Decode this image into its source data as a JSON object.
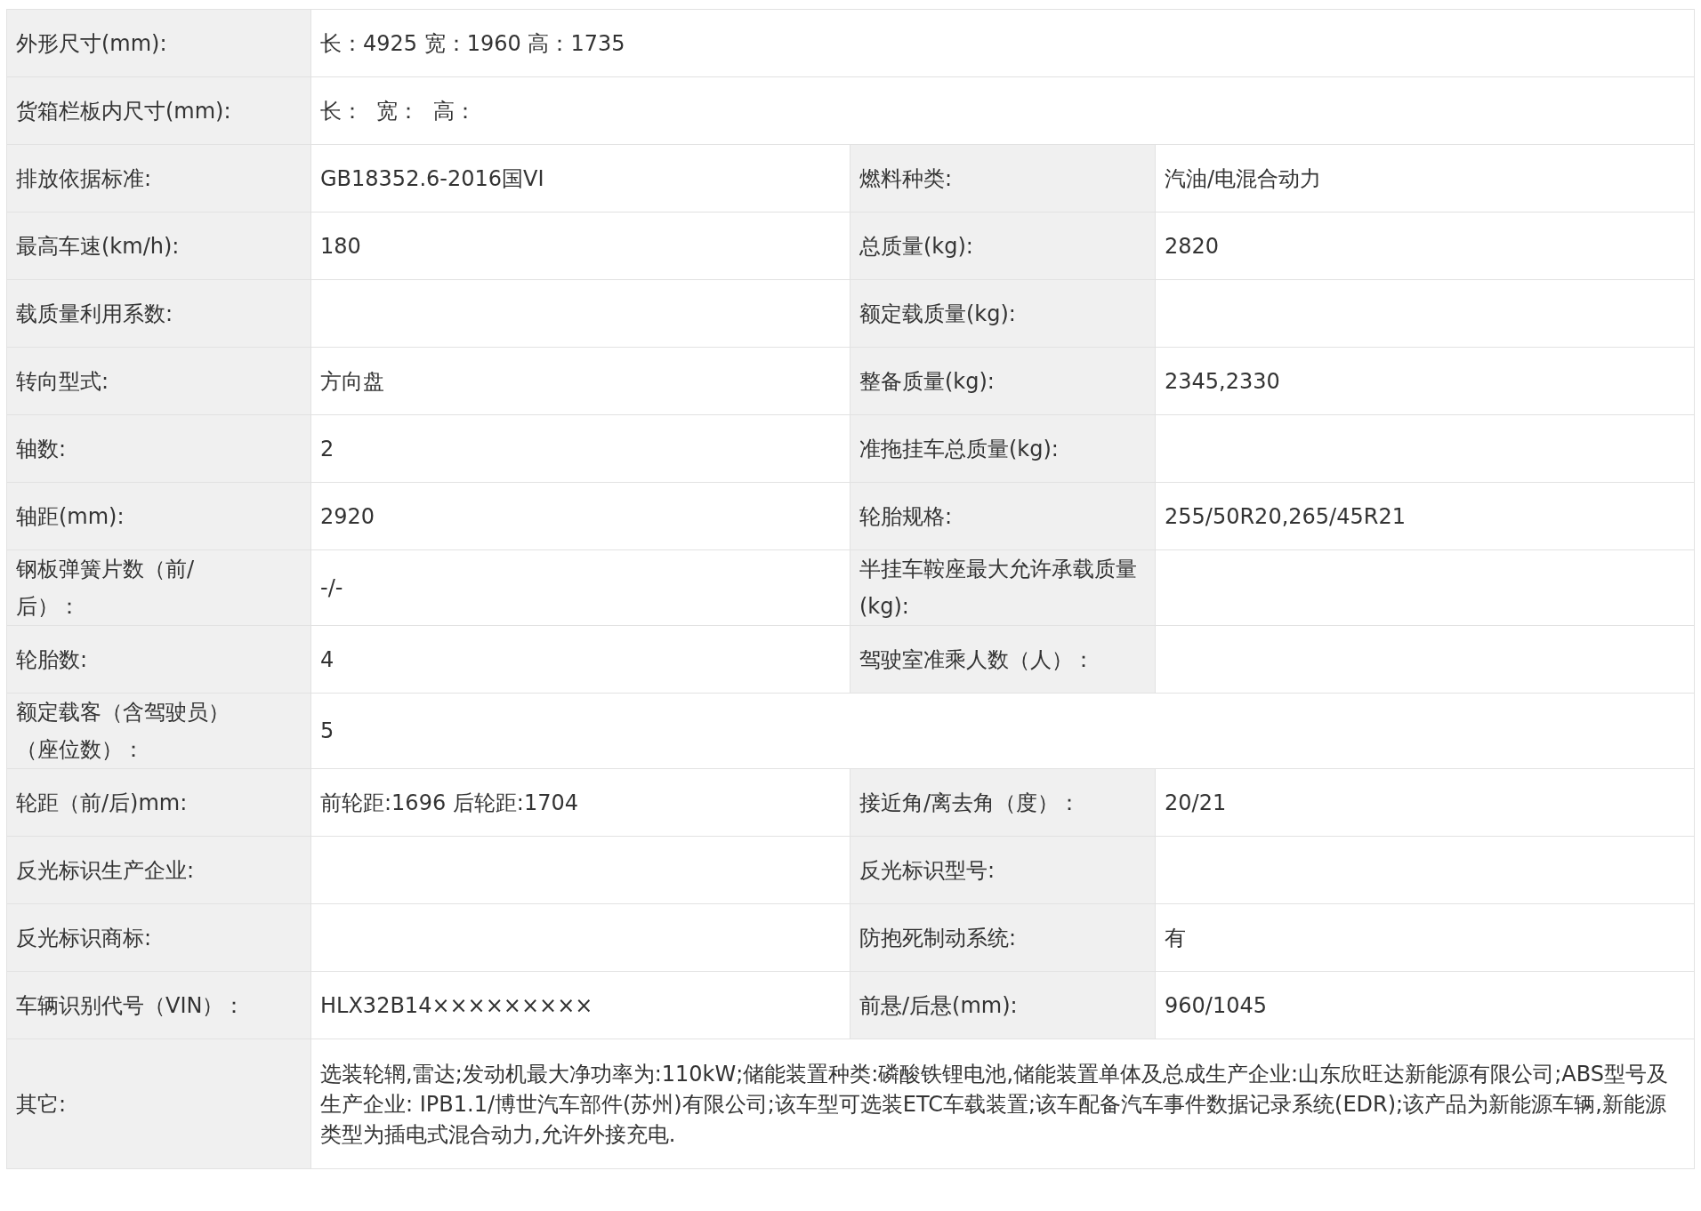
{
  "rows": [
    {
      "kind": "full",
      "label": "外形尺寸(mm):",
      "value": "长：4925 宽：1960 高：1735"
    },
    {
      "kind": "full",
      "label": "货箱栏板内尺寸(mm):",
      "value": "长：  宽：  高："
    },
    {
      "kind": "split",
      "label": "排放依据标准:",
      "value": "GB18352.6-2016国VI",
      "label2": "燃料种类:",
      "value2": "汽油/电混合动力"
    },
    {
      "kind": "split",
      "label": "最高车速(km/h):",
      "value": "180",
      "label2": "总质量(kg):",
      "value2": "2820"
    },
    {
      "kind": "split",
      "label": "载质量利用系数:",
      "label2": "额定载质量(kg):"
    },
    {
      "kind": "split",
      "label": "转向型式:",
      "value": "方向盘",
      "label2": "整备质量(kg):",
      "value2": "2345,2330"
    },
    {
      "kind": "split",
      "label": "轴数:",
      "value": "2",
      "label2": "准拖挂车总质量(kg):"
    },
    {
      "kind": "split",
      "label": "轴距(mm):",
      "value": "2920",
      "label2": "轮胎规格:",
      "value2": "255/50R20,265/45R21"
    },
    {
      "kind": "split",
      "label": "钢板弹簧片数（前/后）：",
      "value": "-/-",
      "label2": "半挂车鞍座最大允许承载质量(kg):"
    },
    {
      "kind": "split",
      "label": "轮胎数:",
      "value": "4",
      "label2": "驾驶室准乘人数（人）："
    },
    {
      "kind": "full",
      "label": "额定载客（含驾驶员）（座位数）：",
      "value": "5"
    },
    {
      "kind": "split",
      "label": "轮距（前/后)mm:",
      "value": "前轮距:1696 后轮距:1704",
      "label2": "接近角/离去角（度）：",
      "value2": "20/21"
    },
    {
      "kind": "split",
      "label": "反光标识生产企业:",
      "label2": "反光标识型号:"
    },
    {
      "kind": "split",
      "label": "反光标识商标:",
      "label2": "防抱死制动系统:",
      "value2": "有"
    },
    {
      "kind": "split",
      "label": "车辆识别代号（VIN）：",
      "value": "HLX32B14×××××××××",
      "label2": "前悬/后悬(mm):",
      "value2": "960/1045"
    },
    {
      "kind": "full",
      "label": "其它:",
      "value": "选装轮辋,雷达;发动机最大净功率为:110kW;储能装置种类:磷酸铁锂电池,储能装置单体及总成生产企业:山东欣旺达新能源有限公司;ABS型号及生产企业: IPB1.1/博世汽车部件(苏州)有限公司;该车型可选装ETC车载装置;该车配备汽车事件数据记录系统(EDR);该产品为新能源车辆,新能源类型为插电式混合动力,允许外接充电."
    }
  ]
}
